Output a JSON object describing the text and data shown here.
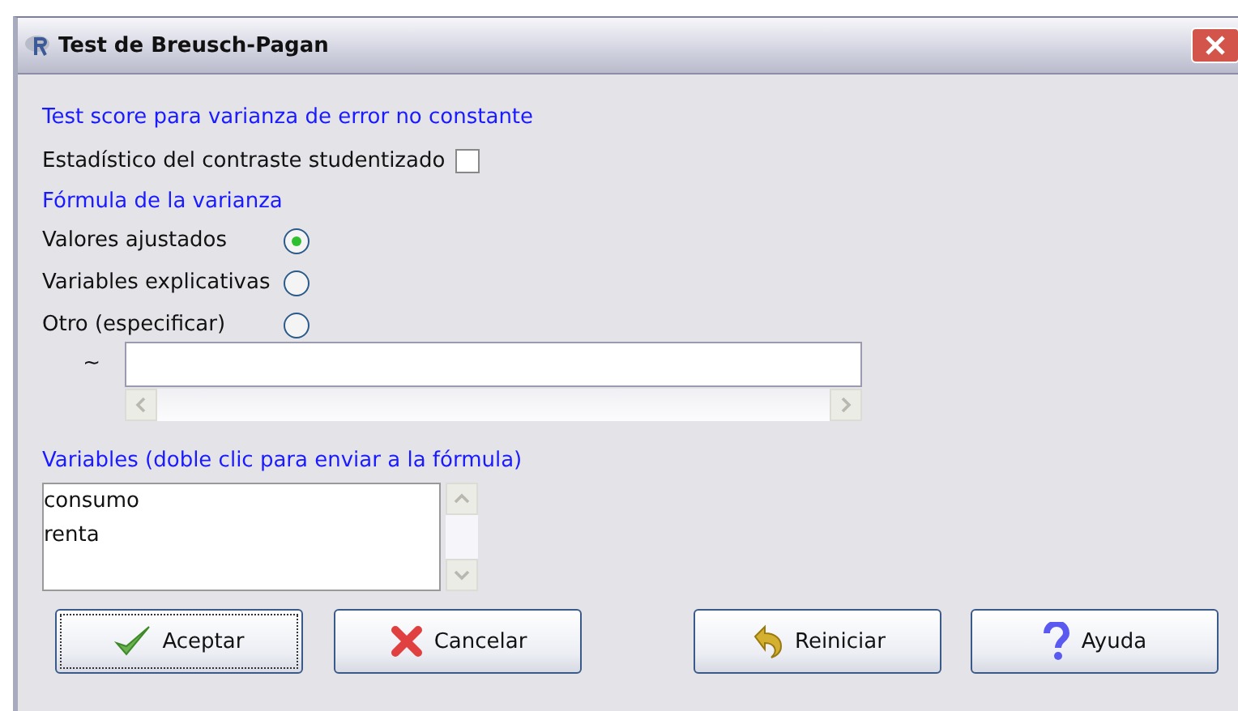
{
  "window": {
    "title": "Test de Breusch-Pagan"
  },
  "test_section": {
    "heading": "Test score para varianza de error no constante",
    "checkbox": {
      "label": "Estadístico del contraste studentizado",
      "checked": false
    }
  },
  "formula_section": {
    "heading": "Fórmula de la varianza",
    "options": [
      {
        "label": "Valores ajustados",
        "selected": true
      },
      {
        "label": "Variables explicativas",
        "selected": false
      },
      {
        "label": "Otro (especificar)",
        "selected": false
      }
    ],
    "tilde": "~"
  },
  "variables": {
    "heading": "Variables (doble clic para enviar a la fórmula)",
    "items": [
      "consumo",
      "renta"
    ]
  },
  "buttons": [
    {
      "label": "Aceptar",
      "kind": "ok",
      "focused": true
    },
    {
      "label": "Cancelar",
      "kind": "cancel",
      "focused": false
    },
    {
      "label": "Reiniciar",
      "kind": "reset",
      "focused": false
    },
    {
      "label": "Ayuda",
      "kind": "help",
      "focused": false
    }
  ]
}
